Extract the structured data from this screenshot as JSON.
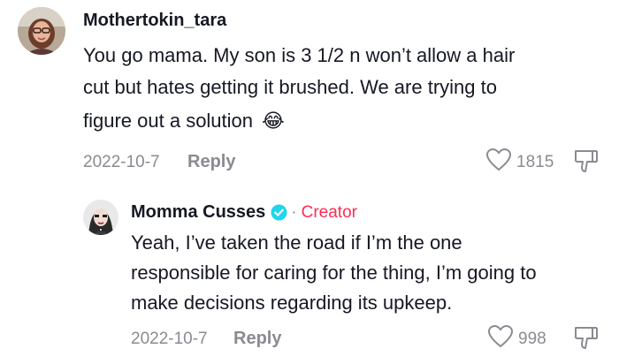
{
  "comment": {
    "username": "Mothertokin_tara",
    "lines": [
      "You go mama. My son is 3 1/2 n won’t allow a hair",
      "cut but hates getting it brushed. We are trying to",
      "figure out a solution"
    ],
    "emoji": "😂",
    "date": "2022-10-7",
    "reply_label": "Reply",
    "like_count": "1815",
    "avatar_icon": "user-avatar-icon"
  },
  "reply": {
    "username": "Momma Cusses",
    "separator": "·",
    "creator_label": "Creator",
    "verified_icon": "verified-badge-icon",
    "lines": [
      "Yeah, I’ve taken the road if I’m the one",
      "responsible for caring for the thing, I’m going to",
      "make decisions regarding its upkeep."
    ],
    "date": "2022-10-7",
    "reply_label": "Reply",
    "like_count": "998",
    "avatar_icon": "creator-avatar-icon"
  },
  "colors": {
    "text": "#161823",
    "muted": "#8a8b91",
    "creator": "#fe2c55",
    "verified": "#20d5ec"
  }
}
